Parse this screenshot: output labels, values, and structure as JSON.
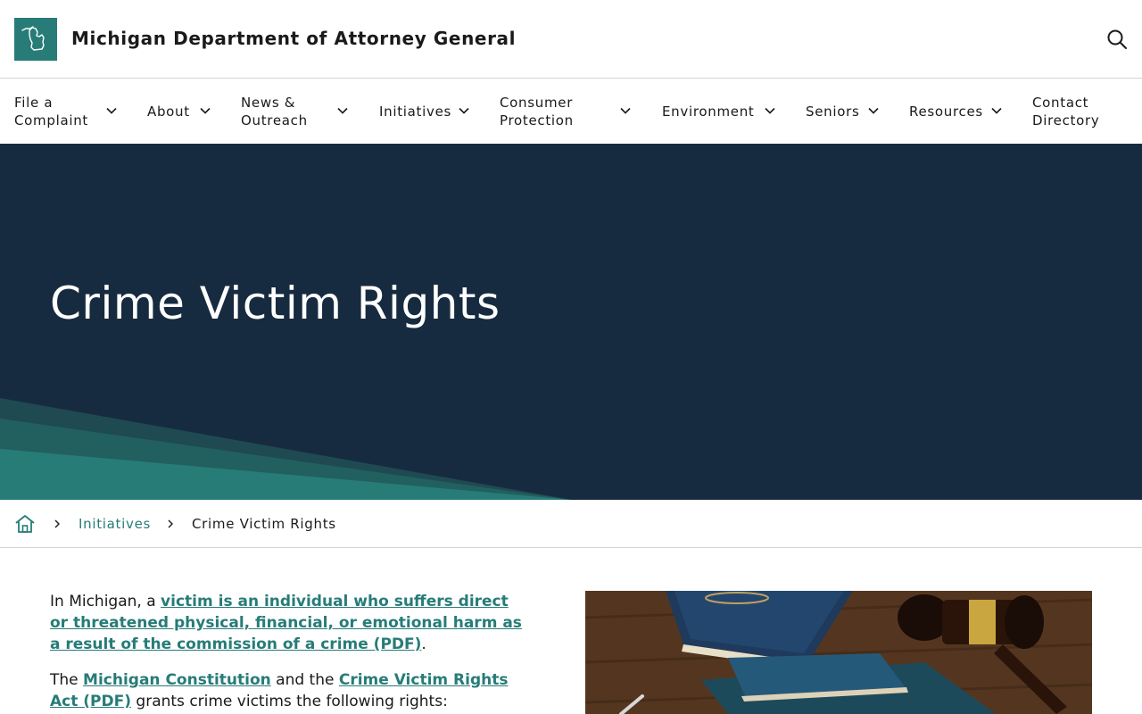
{
  "header": {
    "site_title": "Michigan Department of Attorney General",
    "logo_icon": "michigan-state-icon",
    "search_icon": "search-icon"
  },
  "nav": {
    "items": [
      {
        "label_line1": "File a",
        "label_line2": "Complaint",
        "has_dropdown": true
      },
      {
        "label_line1": "About",
        "label_line2": "",
        "has_dropdown": true
      },
      {
        "label_line1": "News &",
        "label_line2": "Outreach",
        "has_dropdown": true
      },
      {
        "label_line1": "Initiatives",
        "label_line2": "",
        "has_dropdown": true
      },
      {
        "label_line1": "Consumer",
        "label_line2": "Protection",
        "has_dropdown": true
      },
      {
        "label_line1": "Environment",
        "label_line2": "",
        "has_dropdown": true
      },
      {
        "label_line1": "Seniors",
        "label_line2": "",
        "has_dropdown": true
      },
      {
        "label_line1": "Resources",
        "label_line2": "",
        "has_dropdown": true
      },
      {
        "label_line1": "Contact",
        "label_line2": "Directory",
        "has_dropdown": false
      }
    ]
  },
  "hero": {
    "title": "Crime Victim Rights"
  },
  "breadcrumb": {
    "home_icon": "home-icon",
    "items": [
      {
        "label": "Initiatives",
        "link": true
      },
      {
        "label": "Crime Victim Rights",
        "link": false
      }
    ]
  },
  "content": {
    "para1": {
      "prefix": "In Michigan, a ",
      "link": "victim is an individual who suffers direct or threatened physical, financial, or emotional harm as a result of the commission of a crime (PDF)",
      "suffix": "."
    },
    "para2": {
      "prefix": "The ",
      "link1": "Michigan Constitution",
      "middle": " and the ",
      "link2": "Crime Victim Rights Act (PDF)",
      "suffix": " grants crime victims the following rights:"
    }
  },
  "colors": {
    "brand_teal": "#277c78",
    "hero_navy": "#172b40",
    "wave_dark": "#1f4a52",
    "wave_light": "#277c78"
  }
}
